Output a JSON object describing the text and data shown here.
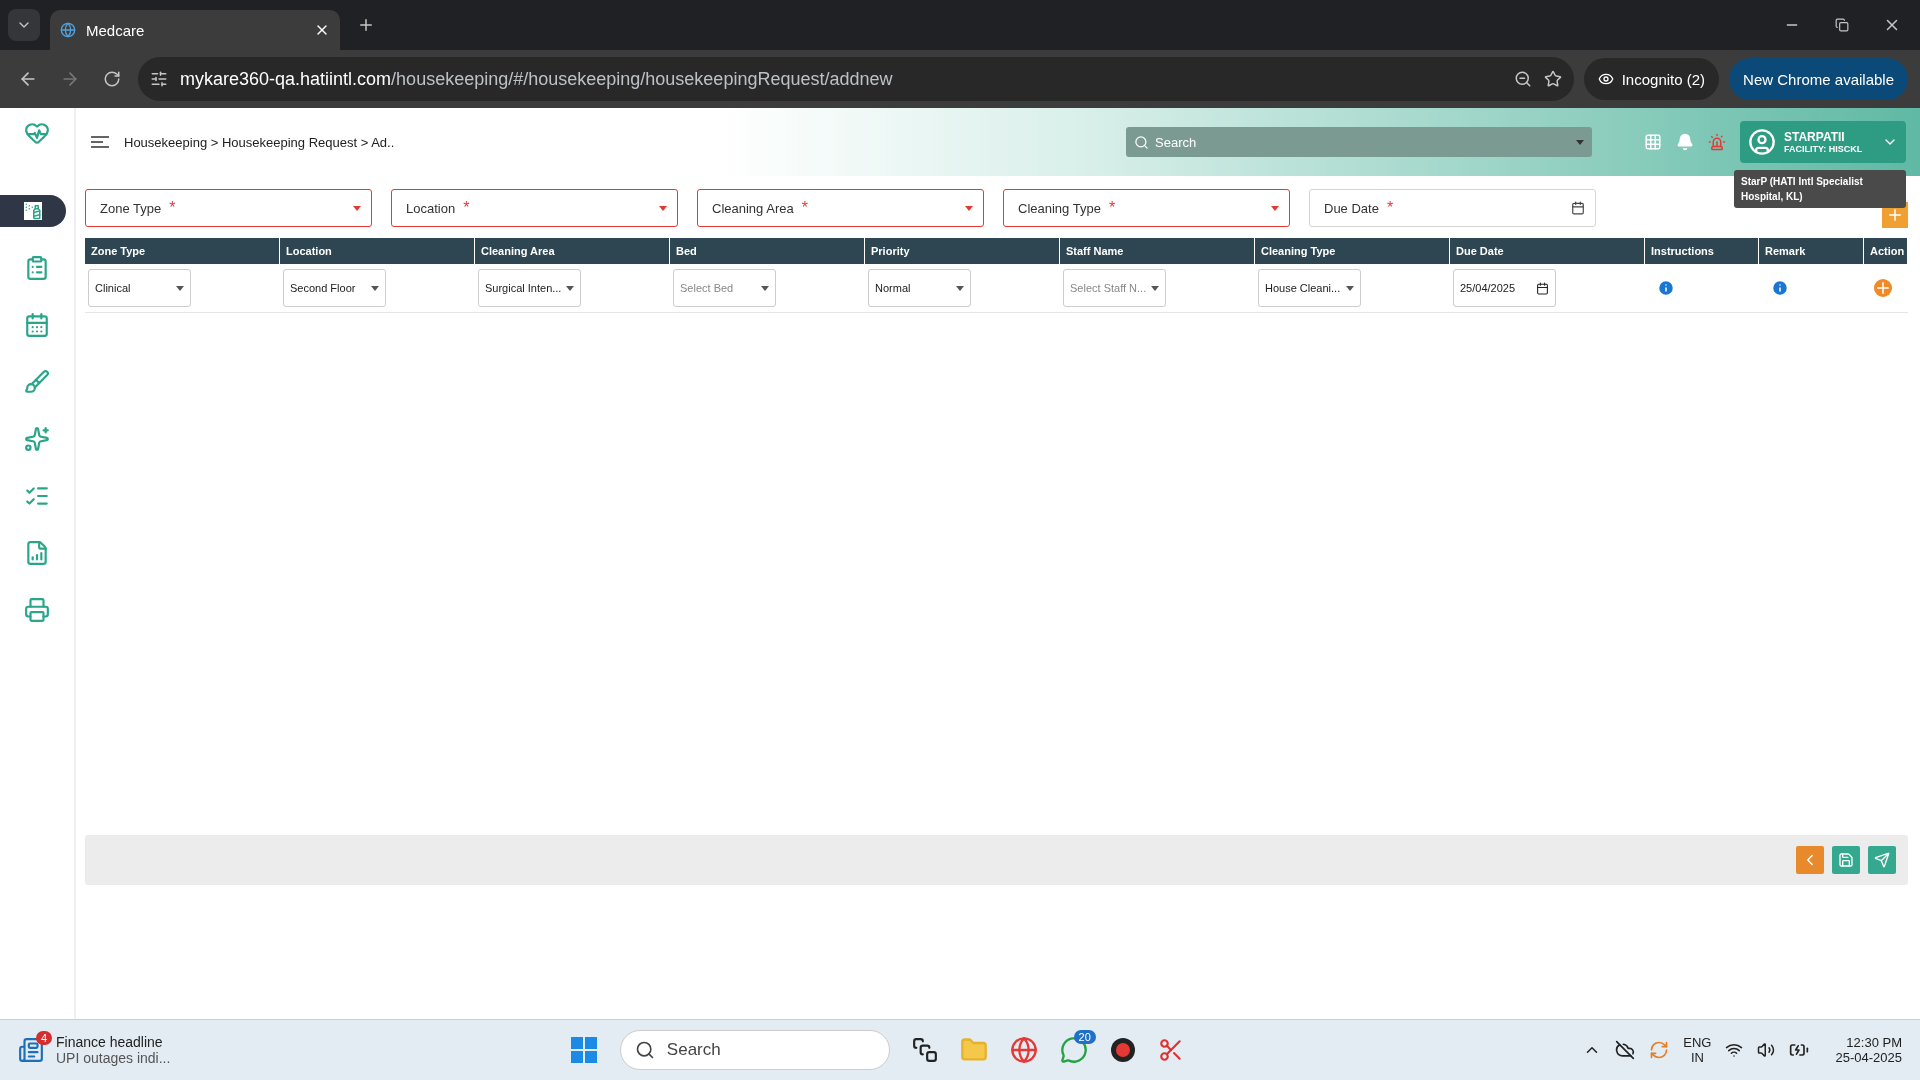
{
  "browser": {
    "tabs": [
      {
        "title": "Medcare",
        "selected": true
      }
    ],
    "url_host": "mykare360-qa.hatiintl.com",
    "url_path": "/housekeeping/#/housekeeping/housekeepingRequest/addnew",
    "incognito": "Incognito (2)",
    "update": "New Chrome available"
  },
  "header": {
    "breadcrumb": "Housekeeping > Housekeeping Request > Ad..",
    "search_placeholder": "Search",
    "user_name": "STARPATII",
    "facility": "FACILITY: HISCKL",
    "tooltip": "StarP (HATI Intl Specialist Hospital, KL)"
  },
  "sidebar": {
    "items": [
      {
        "selected": true
      },
      {
        "selected": false
      },
      {
        "selected": false
      },
      {
        "selected": false
      },
      {
        "selected": false
      },
      {
        "selected": false
      },
      {
        "selected": false
      },
      {
        "selected": false
      }
    ]
  },
  "filters": [
    {
      "label": "Zone Type",
      "required_mark": "*",
      "kind": "dropdown",
      "invalid": true
    },
    {
      "label": "Location",
      "required_mark": "*",
      "kind": "dropdown",
      "invalid": true
    },
    {
      "label": "Cleaning Area",
      "required_mark": "*",
      "kind": "dropdown",
      "invalid": true
    },
    {
      "label": "Cleaning Type",
      "required_mark": "*",
      "kind": "dropdown",
      "invalid": true
    },
    {
      "label": "Due Date",
      "required_mark": "*",
      "kind": "date",
      "invalid": false
    }
  ],
  "table": {
    "columns": [
      "Zone Type",
      "Location",
      "Cleaning Area",
      "Bed",
      "Priority",
      "Staff Name",
      "Cleaning Type",
      "Due Date",
      "Instructions",
      "Remark",
      "Action"
    ],
    "rows": [
      {
        "cells": [
          {
            "kind": "select",
            "value": "Clinical"
          },
          {
            "kind": "select",
            "value": "Second Floor"
          },
          {
            "kind": "select",
            "value": "Surgical Inten..."
          },
          {
            "kind": "select",
            "placeholder": "Select Bed"
          },
          {
            "kind": "select",
            "value": "Normal"
          },
          {
            "kind": "select",
            "placeholder": "Select Staff N..."
          },
          {
            "kind": "select",
            "value": "House Cleani..."
          },
          {
            "kind": "date",
            "value": "25/04/2025"
          },
          {
            "kind": "info"
          },
          {
            "kind": "info"
          },
          {
            "kind": "add"
          }
        ]
      }
    ]
  },
  "taskbar": {
    "news_title": "Finance headline",
    "news_text": "UPI outages indi...",
    "news_badge": "4",
    "search_placeholder": "Search",
    "chat_badge": "20",
    "lang": "ENG",
    "region": "IN",
    "time": "12:30 PM",
    "date": "25-04-2025"
  }
}
